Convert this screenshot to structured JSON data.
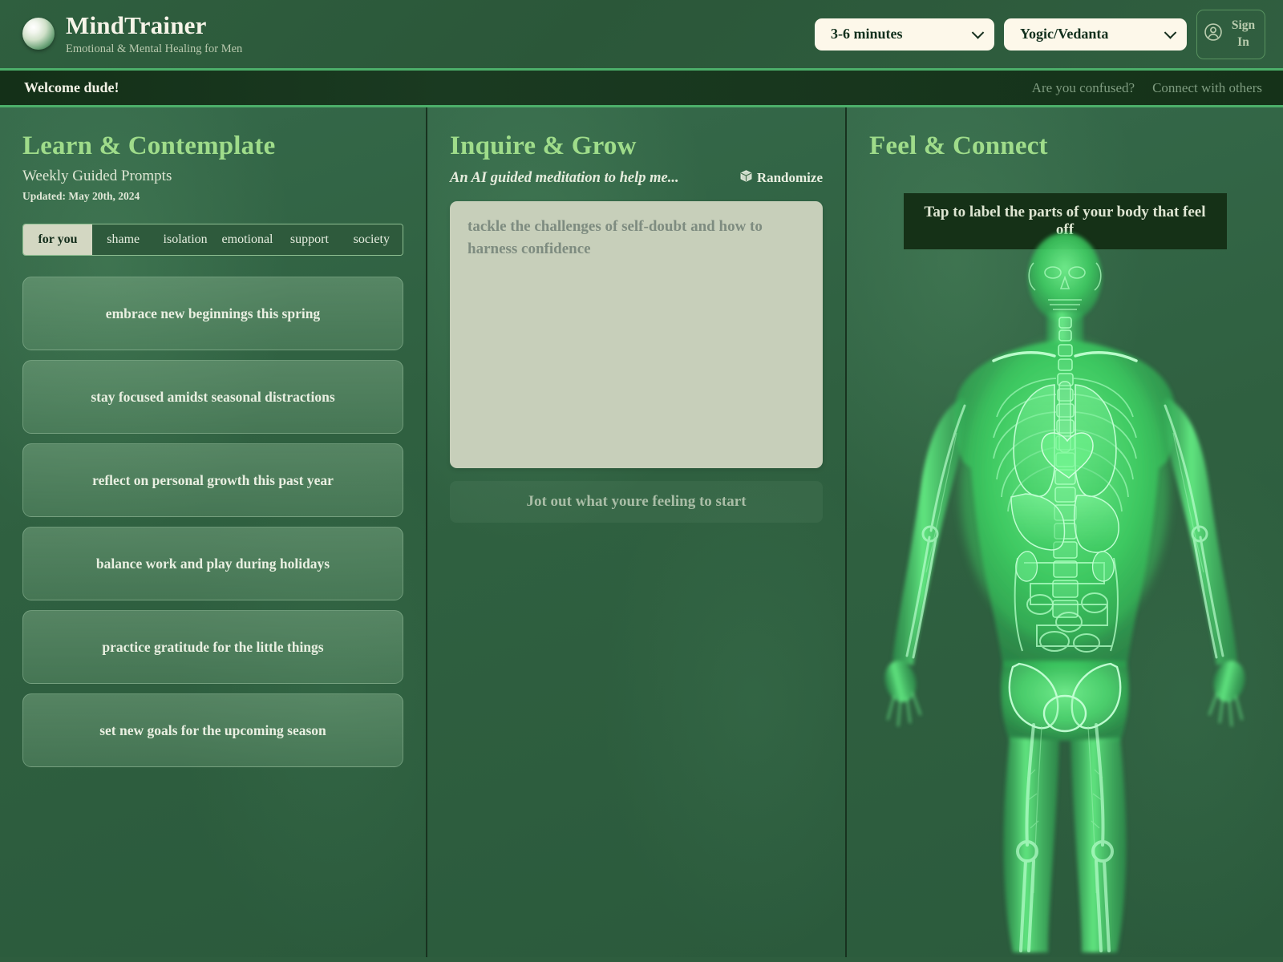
{
  "header": {
    "brand_title": "MindTrainer",
    "brand_subtitle": "Emotional & Mental Healing for Men",
    "logo_icon": "sphere-logo-icon",
    "duration_select": {
      "value": "3-6 minutes",
      "icon": "chevron-down-icon"
    },
    "tradition_select": {
      "value": "Yogic/Vedanta",
      "icon": "chevron-down-icon"
    },
    "sign_in": {
      "label": "Sign In",
      "icon": "user-circle-icon"
    }
  },
  "welcome_bar": {
    "title": "Welcome dude!",
    "links": [
      "Are you confused?",
      "Connect with others"
    ]
  },
  "left_column": {
    "title": "Learn & Contemplate",
    "subtitle": "Weekly Guided Prompts",
    "updated": "Updated: May 20th, 2024",
    "tabs": [
      {
        "label": "for you",
        "active": true
      },
      {
        "label": "shame",
        "active": false
      },
      {
        "label": "isolation",
        "active": false
      },
      {
        "label": "emotional",
        "active": false
      },
      {
        "label": "support",
        "active": false
      },
      {
        "label": "society",
        "active": false
      }
    ],
    "prompts": [
      "embrace new beginnings this spring",
      "stay focused amidst seasonal distractions",
      "reflect on personal growth this past year",
      "balance work and play during holidays",
      "practice gratitude for the little things",
      "set new goals for the upcoming season"
    ]
  },
  "middle_column": {
    "title": "Inquire & Grow",
    "subtitle": "An AI guided meditation to help me...",
    "randomize": {
      "label": "Randomize",
      "icon": "dice-cube-icon"
    },
    "textarea": {
      "value": "",
      "placeholder": "tackle the challenges of self-doubt and how to harness confidence"
    },
    "start_button": "Jot out what youre feeling to start"
  },
  "right_column": {
    "title": "Feel & Connect",
    "banner": "Tap to label the parts of your body that feel off",
    "figure_icon": "human-anatomy-xray-figure"
  },
  "colors": {
    "accent_green": "#9fdc8a",
    "panel_green": "#2f6040",
    "dark_bar": "#153117",
    "cream": "#fdf8ea",
    "sage": "#c7cfba",
    "xray_green": "#3ed96a"
  }
}
